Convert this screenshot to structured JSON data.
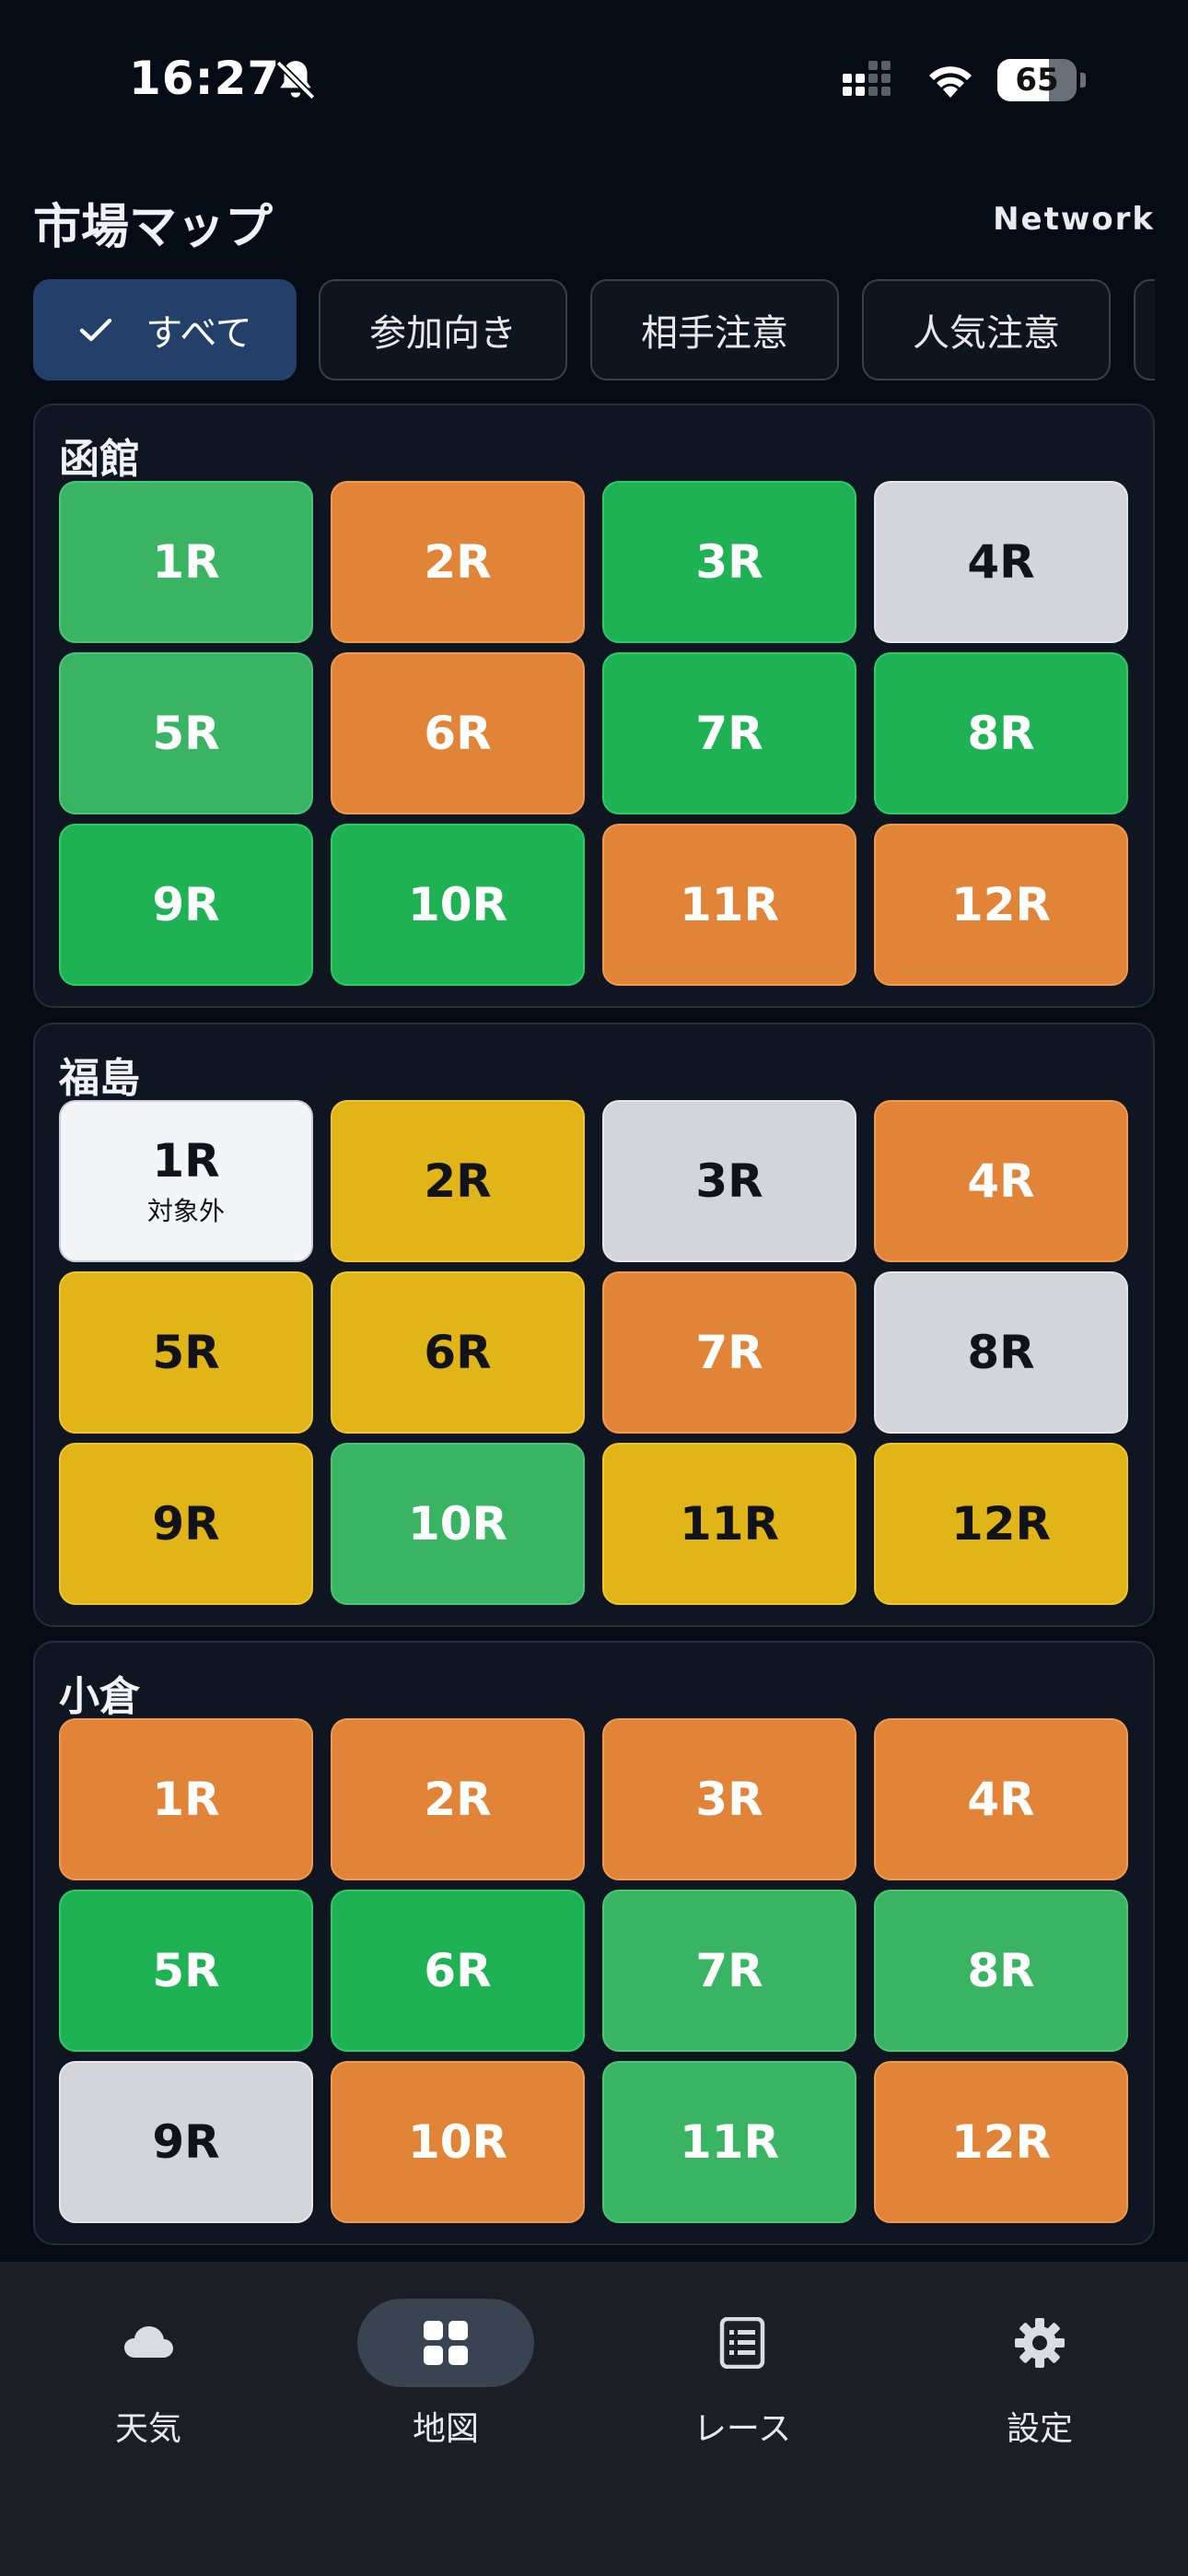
{
  "status_bar": {
    "time": "16:27",
    "battery": "65",
    "battery_level_percent": 65,
    "icons": [
      "bell-slash-icon",
      "cellular-signal-icon",
      "wifi-icon",
      "battery-icon"
    ]
  },
  "header": {
    "title": "市場マップ",
    "network_label": "Network"
  },
  "filters": [
    {
      "label": "すべて",
      "selected": true,
      "icon": "check-icon"
    },
    {
      "label": "参加向き",
      "selected": false
    },
    {
      "label": "相手注意",
      "selected": false
    },
    {
      "label": "人気注意",
      "selected": false
    },
    {
      "label": "",
      "selected": false
    }
  ],
  "colors": {
    "green": "#1fb254",
    "light_green": "#38b463",
    "orange": "#e18437",
    "gray": "#d3d5da",
    "yellow": "#e1b517",
    "white": "#f4f5f8",
    "active_chip": "#23406a"
  },
  "tracks": [
    {
      "name": "函館",
      "races": [
        {
          "label": "1R",
          "color": "light_green"
        },
        {
          "label": "2R",
          "color": "orange"
        },
        {
          "label": "3R",
          "color": "green"
        },
        {
          "label": "4R",
          "color": "gray"
        },
        {
          "label": "5R",
          "color": "light_green"
        },
        {
          "label": "6R",
          "color": "orange"
        },
        {
          "label": "7R",
          "color": "green"
        },
        {
          "label": "8R",
          "color": "green"
        },
        {
          "label": "9R",
          "color": "green"
        },
        {
          "label": "10R",
          "color": "green"
        },
        {
          "label": "11R",
          "color": "orange"
        },
        {
          "label": "12R",
          "color": "orange"
        }
      ]
    },
    {
      "name": "福島",
      "races": [
        {
          "label": "1R",
          "color": "white",
          "sub": "対象外"
        },
        {
          "label": "2R",
          "color": "yellow"
        },
        {
          "label": "3R",
          "color": "gray"
        },
        {
          "label": "4R",
          "color": "orange"
        },
        {
          "label": "5R",
          "color": "yellow"
        },
        {
          "label": "6R",
          "color": "yellow"
        },
        {
          "label": "7R",
          "color": "orange"
        },
        {
          "label": "8R",
          "color": "gray"
        },
        {
          "label": "9R",
          "color": "yellow"
        },
        {
          "label": "10R",
          "color": "light_green"
        },
        {
          "label": "11R",
          "color": "yellow"
        },
        {
          "label": "12R",
          "color": "yellow"
        }
      ]
    },
    {
      "name": "小倉",
      "races": [
        {
          "label": "1R",
          "color": "orange"
        },
        {
          "label": "2R",
          "color": "orange"
        },
        {
          "label": "3R",
          "color": "orange"
        },
        {
          "label": "4R",
          "color": "orange"
        },
        {
          "label": "5R",
          "color": "green"
        },
        {
          "label": "6R",
          "color": "green"
        },
        {
          "label": "7R",
          "color": "light_green"
        },
        {
          "label": "8R",
          "color": "light_green"
        },
        {
          "label": "9R",
          "color": "gray"
        },
        {
          "label": "10R",
          "color": "orange"
        },
        {
          "label": "11R",
          "color": "light_green"
        },
        {
          "label": "12R",
          "color": "orange"
        }
      ]
    }
  ],
  "bottom_nav": [
    {
      "label": "天気",
      "icon": "cloud-icon",
      "active": false
    },
    {
      "label": "地図",
      "icon": "grid-icon",
      "active": true
    },
    {
      "label": "レース",
      "icon": "list-icon",
      "active": false
    },
    {
      "label": "設定",
      "icon": "gear-icon",
      "active": false
    }
  ]
}
